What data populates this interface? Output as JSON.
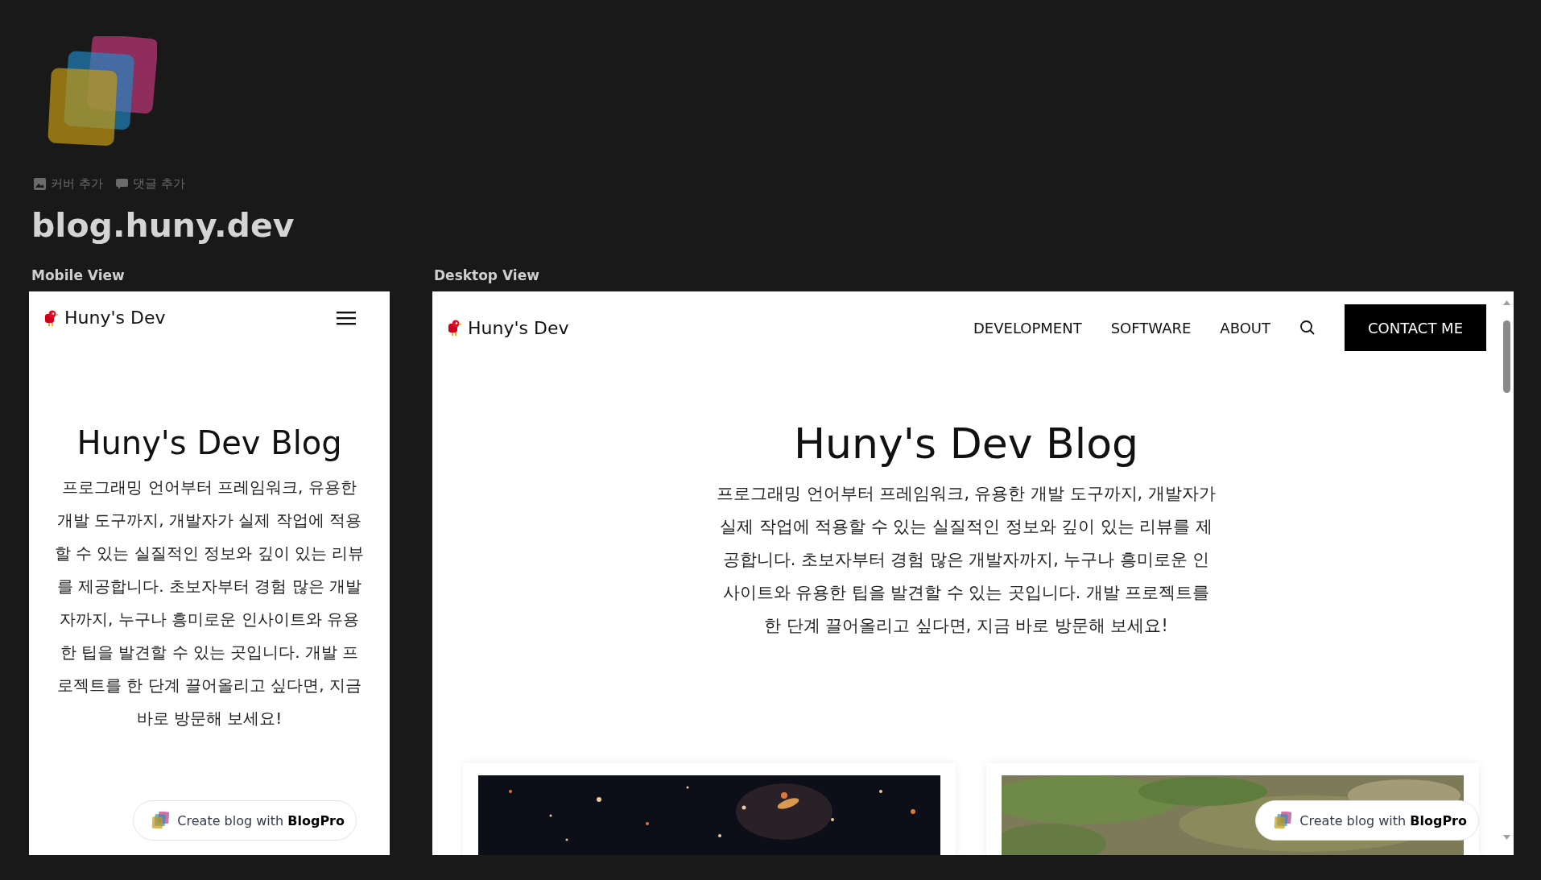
{
  "page": {
    "actions": [
      {
        "kind": "cover",
        "label": "커버 추가"
      },
      {
        "kind": "comment",
        "label": "댓글 추가"
      }
    ],
    "title": "blog.huny.dev"
  },
  "mobile_view": {
    "label": "Mobile View",
    "brand": "Huny's Dev",
    "hero_title": "Huny's Dev Blog",
    "hero_text": "프로그래밍 언어부터 프레임워크, 유용한 개발 도구까지, 개발자가 실제 작업에 적용할 수 있는 실질적인 정보와 깊이 있는 리뷰를 제공합니다. 초보자부터 경험 많은 개발자까지, 누구나 흥미로운 인사이트와 유용한 팁을 발견할 수 있는 곳입니다. 개발 프로젝트를 한 단계 끌어올리고 싶다면, 지금 바로 방문해 보세요!",
    "badge": "Create blog with **BlogPro**"
  },
  "desktop_view": {
    "label": "Desktop View",
    "brand": "Huny's Dev",
    "nav": [
      "DEVELOPMENT",
      "SOFTWARE",
      "ABOUT"
    ],
    "cta": "CONTACT ME",
    "hero_title": "Huny's Dev Blog",
    "hero_text": "프로그래밍 언어부터 프레임워크, 유용한 개발 도구까지, 개발자가 실제 작업에 적용할 수 있는 실질적인 정보와 깊이 있는 리뷰를 제공합니다. 초보자부터 경험 많은 개발자까지, 누구나 흥미로운 인사이트와 유용한 팁을 발견할 수 있는 곳입니다. 개발 프로젝트를 한 단계 끌어올리고 싶다면, 지금 바로 방문해 보세요!",
    "badge": "Create blog with **BlogPro**"
  }
}
